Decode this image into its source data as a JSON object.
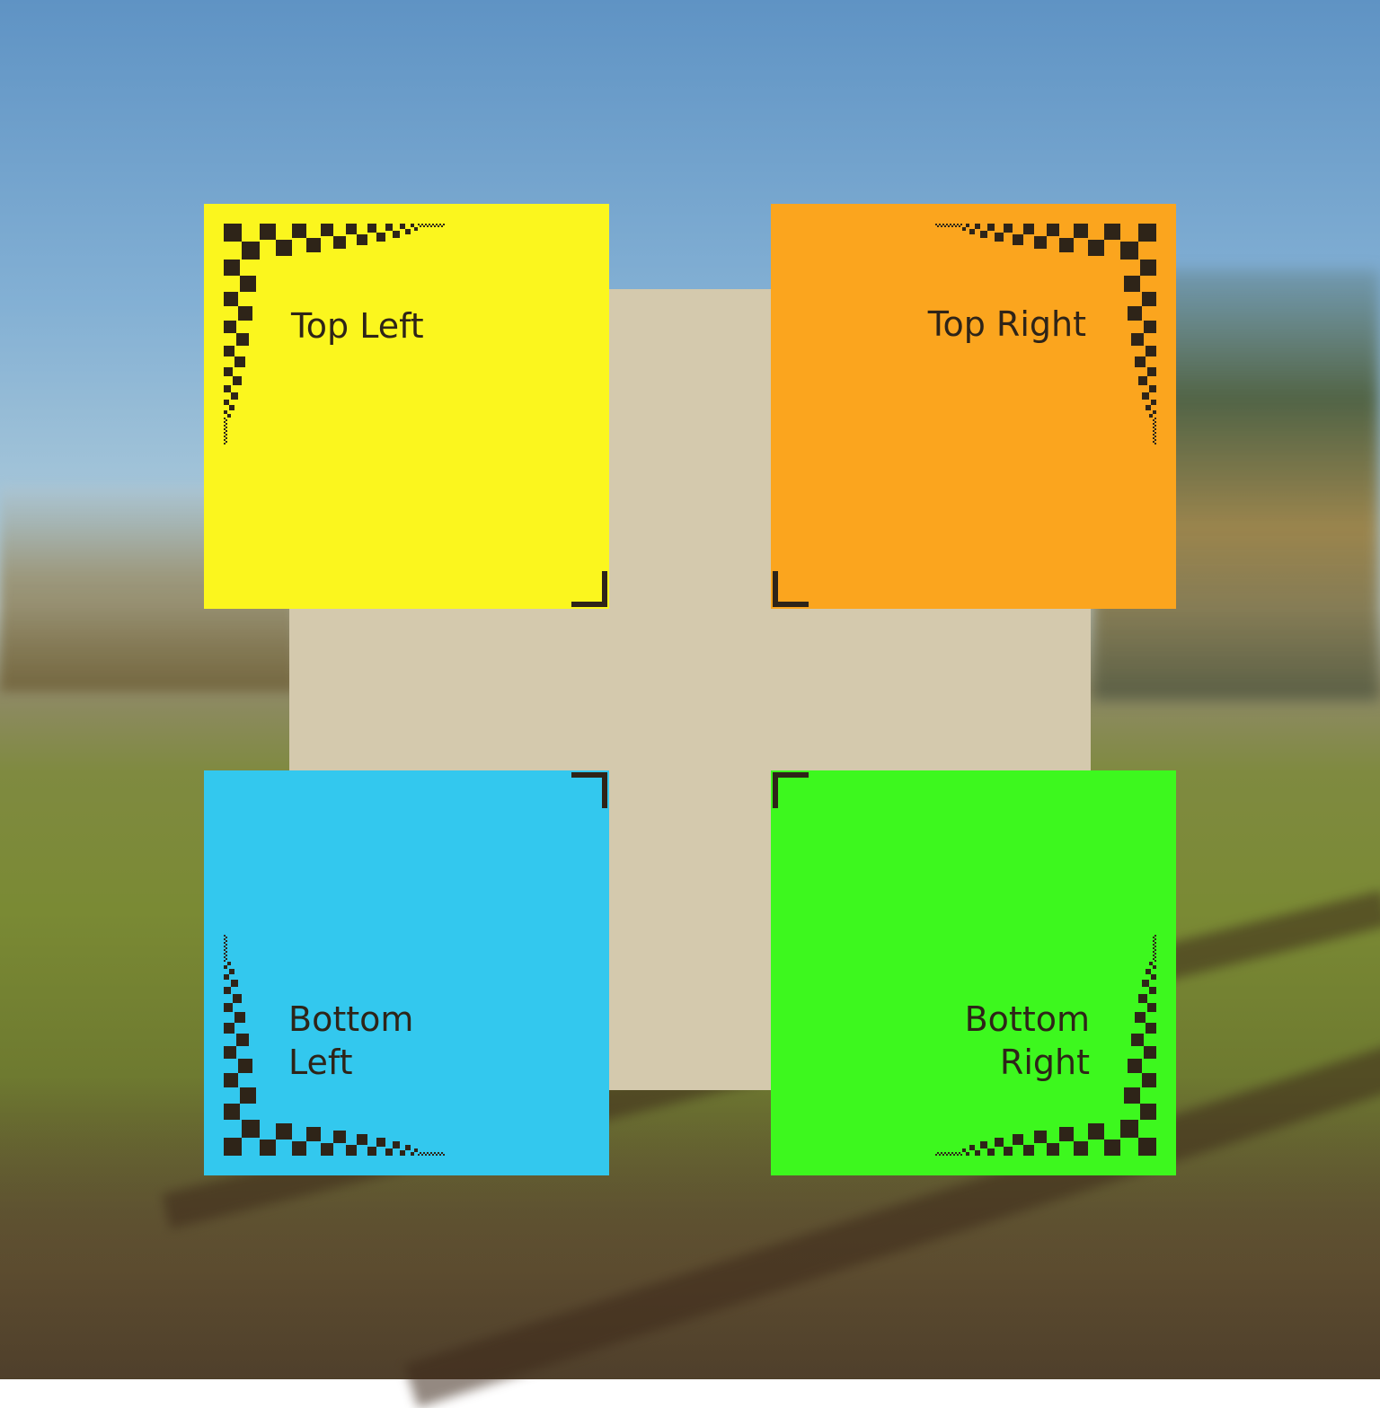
{
  "desktop": {
    "wallpaper": "misty meadow with trees and dirt track",
    "backdrop_color": "#d4c9ad"
  },
  "notes": [
    {
      "id": "top-left",
      "color": "#fbf61e",
      "line1": "Top Left",
      "line2": ""
    },
    {
      "id": "top-right",
      "color": "#fba51e",
      "line1": "Top Right",
      "line2": ""
    },
    {
      "id": "bottom-left",
      "color": "#33c8ee",
      "line1": "Bottom",
      "line2": "Left"
    },
    {
      "id": "bottom-right",
      "color": "#3df81e",
      "line1": "Bottom",
      "line2": "Right"
    }
  ],
  "decoration": {
    "checker_color": "#2e2418",
    "icon": "checkered-corner-icon"
  }
}
